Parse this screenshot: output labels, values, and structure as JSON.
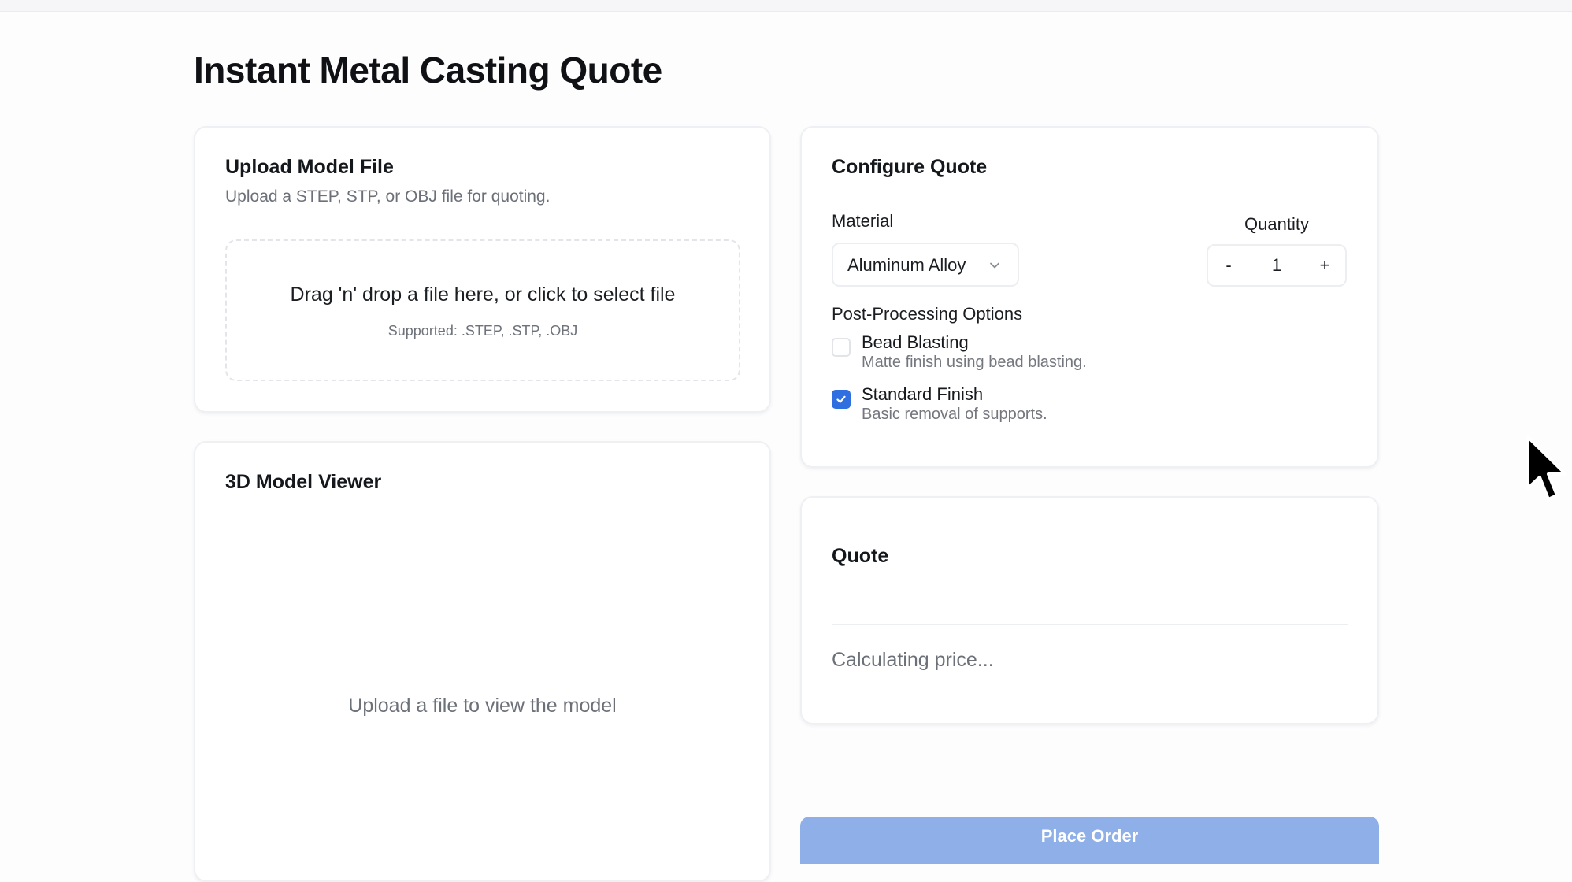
{
  "page": {
    "title": "Instant Metal Casting Quote"
  },
  "upload": {
    "title": "Upload Model File",
    "subtitle": "Upload a STEP, STP, or OBJ file for quoting.",
    "dropzone_text": "Drag 'n' drop a file here, or click to select file",
    "dropzone_hint": "Supported: .STEP, .STP, .OBJ"
  },
  "viewer": {
    "title": "3D Model Viewer",
    "empty_text": "Upload a file to view the model"
  },
  "config": {
    "title": "Configure Quote",
    "material_label": "Material",
    "material_value": "Aluminum Alloy",
    "quantity_label": "Quantity",
    "quantity_minus": "-",
    "quantity_value": "1",
    "quantity_plus": "+",
    "post_processing_label": "Post-Processing Options",
    "options": [
      {
        "title": "Bead Blasting",
        "description": "Matte finish using bead blasting.",
        "checked": false
      },
      {
        "title": "Standard Finish",
        "description": "Basic removal of supports.",
        "checked": true
      }
    ]
  },
  "quote": {
    "title": "Quote",
    "status": "Calculating price..."
  },
  "actions": {
    "place_order": "Place Order"
  },
  "icons": {
    "select": "chevron-down-icon",
    "checkbox": "check-icon",
    "pointer": "mouse-cursor-icon"
  },
  "colors": {
    "accent": "#2f6fe0",
    "place_order_bg": "#8eafe8"
  }
}
